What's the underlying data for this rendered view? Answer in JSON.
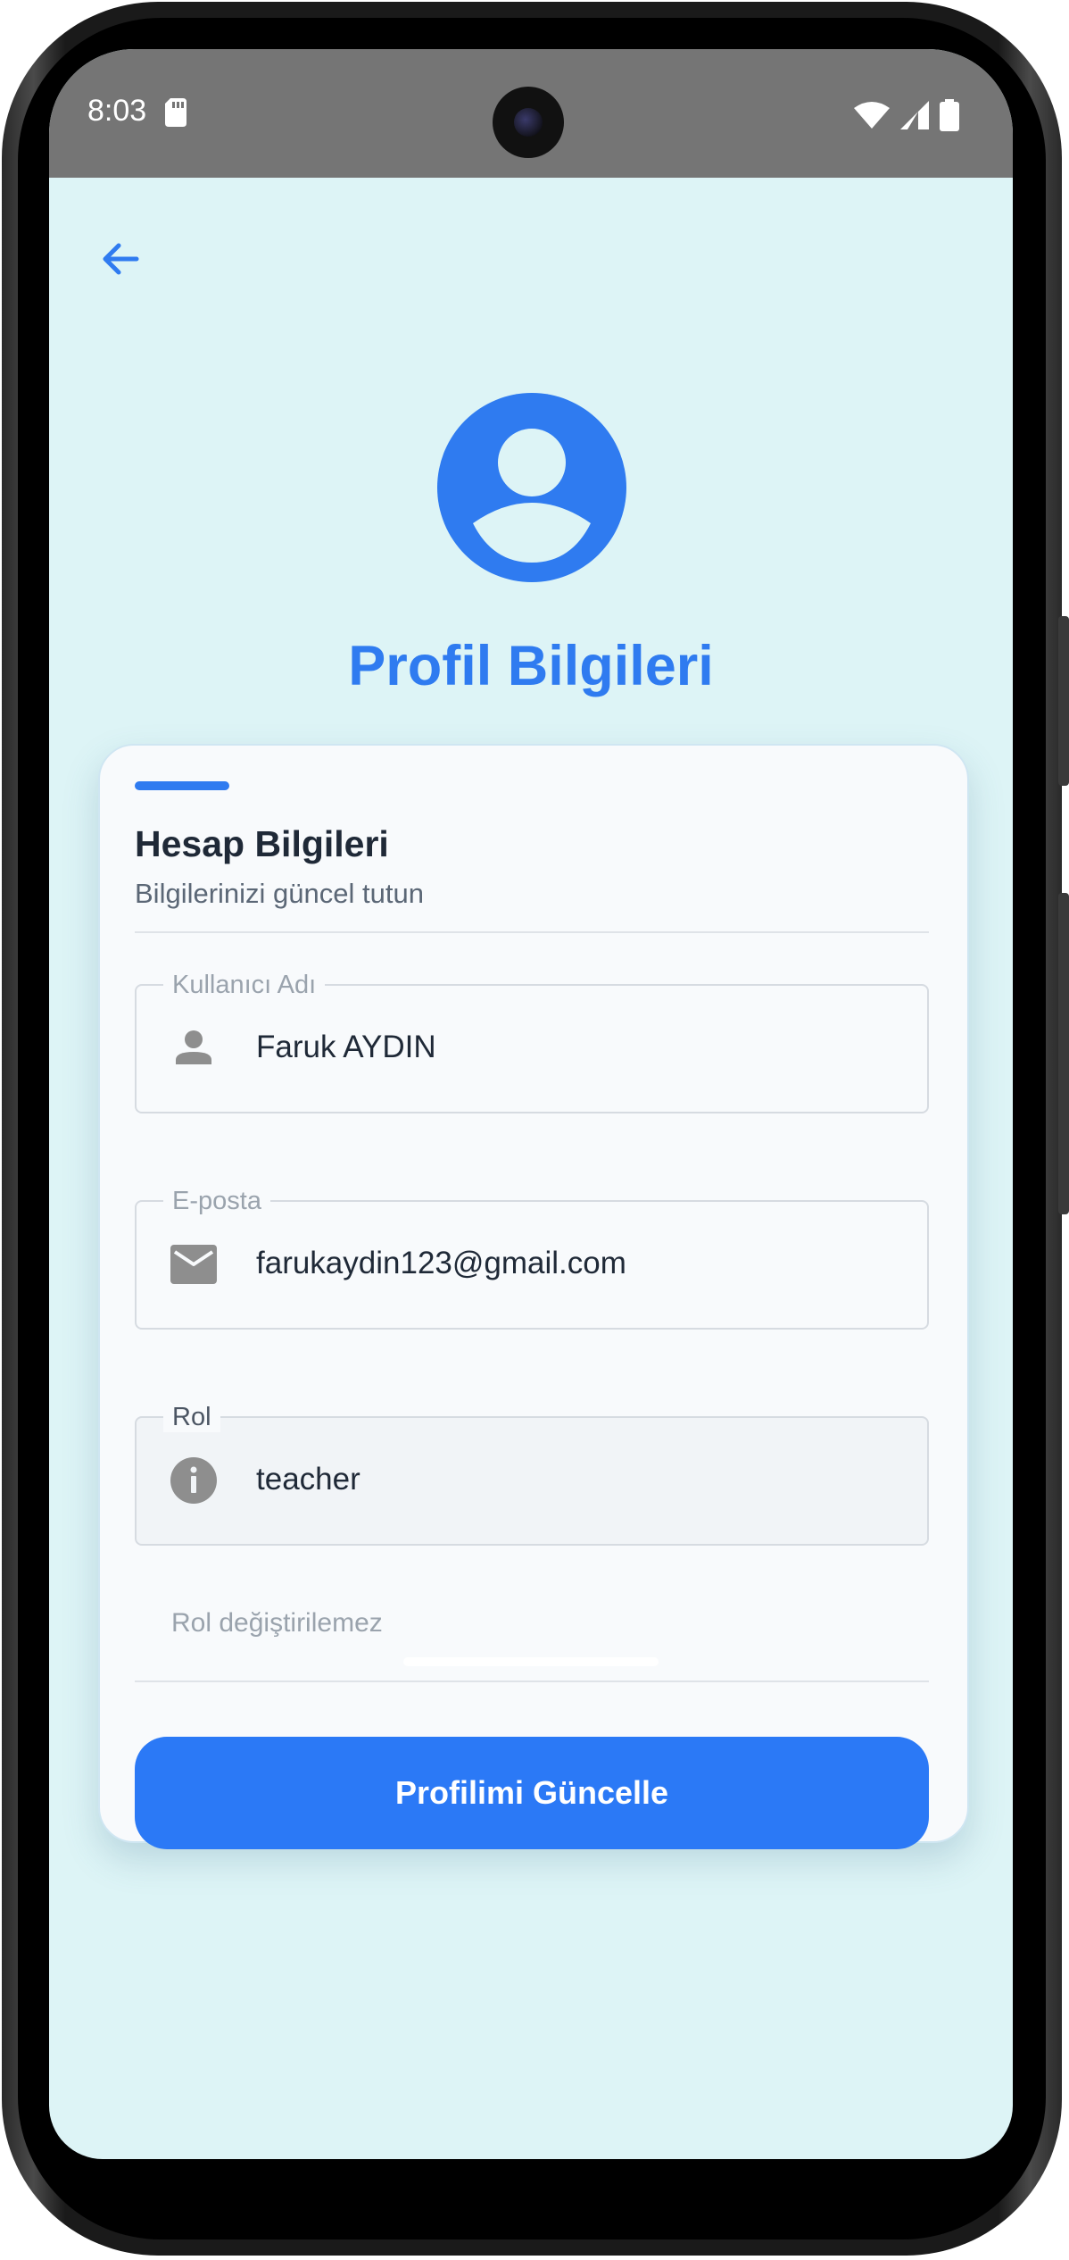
{
  "status_bar": {
    "time": "8:03"
  },
  "header": {
    "title": "Profil Bilgileri"
  },
  "card": {
    "title": "Hesap Bilgileri",
    "subtitle": "Bilgilerinizi güncel tutun",
    "fields": {
      "username": {
        "label": "Kullanıcı Adı",
        "value": "Faruk AYDIN",
        "icon": "person-icon"
      },
      "email": {
        "label": "E-posta",
        "value": "farukaydin123@gmail.com",
        "icon": "mail-icon"
      },
      "role": {
        "label": "Rol",
        "value": "teacher",
        "icon": "info-icon",
        "helper": "Rol değiştirilemez"
      }
    },
    "submit_label": "Profilimi Güncelle"
  },
  "colors": {
    "accent": "#2f7bf0",
    "button": "#2b79f6",
    "background": "#ddf4f6",
    "status_bar": "#757575"
  }
}
